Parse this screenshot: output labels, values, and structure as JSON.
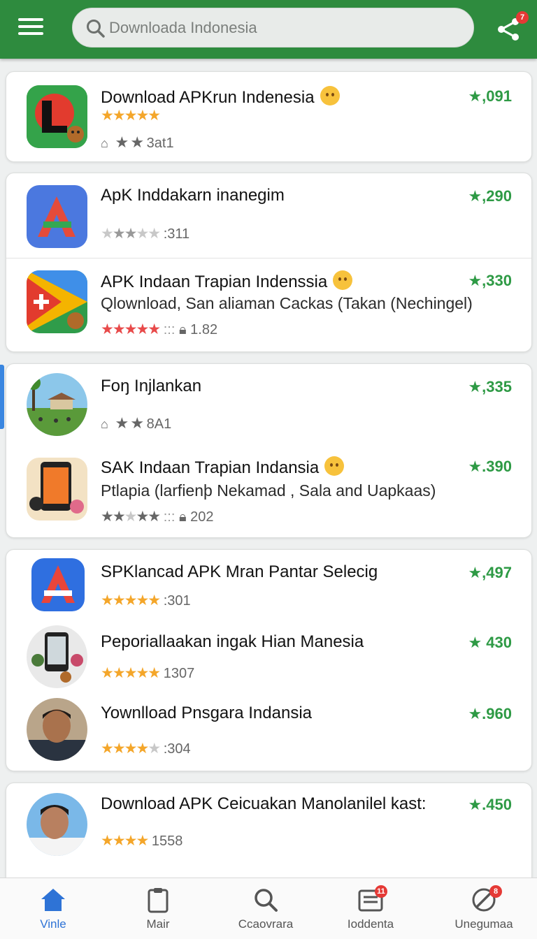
{
  "search": {
    "placeholder": "Downloada Indonesia"
  },
  "share": {
    "badge": "7"
  },
  "apps": [
    {
      "title": "Download APKrun Indenesia",
      "rating": "★,091",
      "meta": "3at1"
    },
    {
      "title": "ApK Inddakarn inanegim",
      "rating": "★,290",
      "meta": ":311"
    },
    {
      "title": "APK Indaan Trapian Indenssia",
      "subtitle": "Qlownload, San aliaman Cackas (Takan (Nechingel)",
      "rating": "★,330",
      "meta": "1.82"
    },
    {
      "title": "Foŋ Injlankan",
      "rating": "★,335",
      "meta": "8A1"
    },
    {
      "title": "SAK Indaan Trapian Indansia",
      "subtitle": "Ptlapia (larfienþ Nekamad , Sala and Uapkaas)",
      "rating": "★.390",
      "meta": "202"
    },
    {
      "title": "SPKlancad APK Mran Pantar Selecig",
      "rating": "★,497",
      "meta": ":301"
    },
    {
      "title": "Peporiallaakan ingak Hian Manesia",
      "rating": "★ 430",
      "meta": "1307"
    },
    {
      "title": "Yownlload Pnsgara Indansia",
      "rating": "★.960",
      "meta": ":304"
    },
    {
      "title": "Download APK Ceicuakan Manolanilel kast:",
      "rating": "★.450",
      "meta": "1558"
    }
  ],
  "nav": [
    {
      "label": "Vinle",
      "icon": "home-icon"
    },
    {
      "label": "Mair",
      "icon": "clipboard-icon"
    },
    {
      "label": "Ccaovrara",
      "icon": "search-icon"
    },
    {
      "label": "Ioddenta",
      "icon": "inbox-icon",
      "badge": "11"
    },
    {
      "label": "Unegumaa",
      "icon": "compass-icon",
      "badge": "8"
    }
  ],
  "colors": {
    "brand": "#2e8b3e",
    "rating": "#2e9a45",
    "active": "#2e73d6"
  }
}
